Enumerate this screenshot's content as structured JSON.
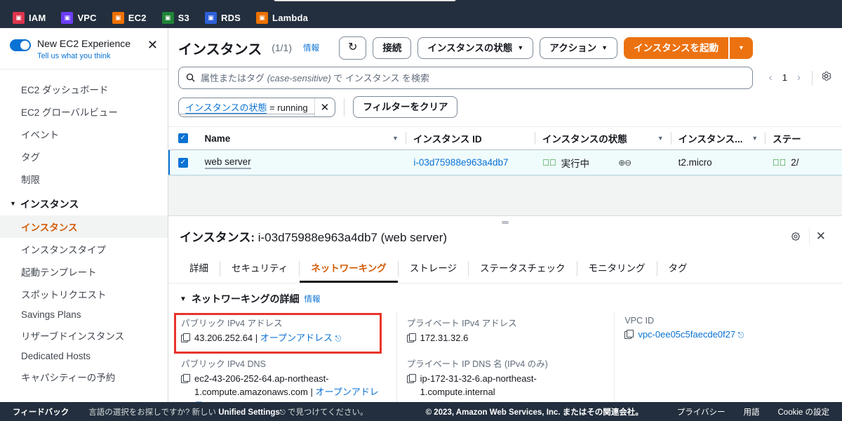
{
  "topnav": {
    "services": [
      {
        "label": "IAM",
        "icon": "iam-icon",
        "color": "#dd344c"
      },
      {
        "label": "VPC",
        "icon": "vpc-icon",
        "color": "#6b3df5"
      },
      {
        "label": "EC2",
        "icon": "ec2-icon",
        "color": "#ed7100"
      },
      {
        "label": "S3",
        "icon": "s3-icon",
        "color": "#1f8437"
      },
      {
        "label": "RDS",
        "icon": "rds-icon",
        "color": "#2e5fd9"
      },
      {
        "label": "Lambda",
        "icon": "lambda-icon",
        "color": "#ed7100"
      }
    ]
  },
  "sidebar": {
    "experience": {
      "title": "New EC2 Experience",
      "subtitle": "Tell us what you think",
      "toggle_on": true,
      "close_label": "✕"
    },
    "items": [
      {
        "label": "EC2 ダッシュボード",
        "active": false
      },
      {
        "label": "EC2 グローバルビュー",
        "active": false
      },
      {
        "label": "イベント",
        "active": false
      },
      {
        "label": "タグ",
        "active": false
      },
      {
        "label": "制限",
        "active": false
      }
    ],
    "group_label": "インスタンス",
    "group_items": [
      {
        "label": "インスタンス",
        "active": true
      },
      {
        "label": "インスタンスタイプ",
        "active": false
      },
      {
        "label": "起動テンプレート",
        "active": false
      },
      {
        "label": "スポットリクエスト",
        "active": false
      },
      {
        "label": "Savings Plans",
        "active": false
      },
      {
        "label": "リザーブドインスタンス",
        "active": false
      },
      {
        "label": "Dedicated Hosts",
        "active": false
      },
      {
        "label": "キャパシティーの予約",
        "active": false
      }
    ]
  },
  "header": {
    "title": "インスタンス",
    "count": "(1/1)",
    "info_label": "情報",
    "refresh_icon": "refresh-icon",
    "connect_label": "接続",
    "instance_state_label": "インスタンスの状態",
    "actions_label": "アクション",
    "launch_label": "インスタンスを起動",
    "caret": "▼"
  },
  "search": {
    "icon": "search-icon",
    "placeholder_a": "属性またはタグ",
    "placeholder_b": "(case-sensitive)",
    "placeholder_c": "で インスタンス を検索",
    "value": ""
  },
  "pager": {
    "prev": "‹",
    "page": "1",
    "next": "›",
    "settings_icon": "gear-icon"
  },
  "filters": {
    "token_key": "インスタンスの状態",
    "token_op": " = running",
    "token_remove": "✕",
    "clear_label": "フィルターをクリア"
  },
  "table": {
    "select_all_checked": true,
    "columns": [
      {
        "label": "Name",
        "sortable": true
      },
      {
        "label": "インスタンス ID",
        "sortable": false
      },
      {
        "label": "インスタンスの状態",
        "sortable": true
      },
      {
        "label": "インスタンス...",
        "sortable": true
      },
      {
        "label": "ステー",
        "sortable": false
      }
    ],
    "rows": [
      {
        "checked": true,
        "name": "web server",
        "instance_id": "i-03d75988e963a4db7",
        "state": "実行中",
        "state_icon": "check-circle-icon",
        "zoom_icons": "zoom-in-out-icon",
        "type": "t2.micro",
        "status": "2/",
        "status_icon": "check-circle-icon"
      }
    ]
  },
  "details": {
    "grabber": "═",
    "title_prefix": "インスタンス: ",
    "instance_id": "i-03d75988e963a4db7 (web server)",
    "gear_icon": "gear-icon",
    "close_icon": "close-icon",
    "tabs": [
      {
        "label": "詳細",
        "active": false
      },
      {
        "label": "セキュリティ",
        "active": false
      },
      {
        "label": "ネットワーキング",
        "active": true
      },
      {
        "label": "ストレージ",
        "active": false
      },
      {
        "label": "ステータスチェック",
        "active": false
      },
      {
        "label": "モニタリング",
        "active": false
      },
      {
        "label": "タグ",
        "active": false
      }
    ],
    "section": {
      "caret": "▼",
      "title": "ネットワーキングの詳細",
      "info_label": "情報"
    },
    "fields": [
      {
        "label": "パブリック IPv4 アドレス",
        "value": "43.206.252.64",
        "separator": " | ",
        "link": "オープンアドレス",
        "external": true,
        "copy": true,
        "highlight": true
      },
      {
        "label": "プライベート IPv4 アドレス",
        "value": "172.31.32.6",
        "separator": "",
        "link": "",
        "external": false,
        "copy": true,
        "highlight": false
      },
      {
        "label": "VPC ID",
        "value": "",
        "separator": "",
        "link": "vpc-0ee05c5faecde0f27",
        "external": true,
        "copy": true,
        "highlight": false
      },
      {
        "label": "パブリック IPv4 DNS",
        "value": "ec2-43-206-252-64.ap-northeast-1.compute.amazonaws.com",
        "separator": " | ",
        "link": "オープンアドレス",
        "external": true,
        "copy": true,
        "highlight": false
      },
      {
        "label": "プライベート IP DNS 名 (IPv4 のみ)",
        "value": "ip-172-31-32-6.ap-northeast-1.compute.internal",
        "separator": "",
        "link": "",
        "external": false,
        "copy": true,
        "highlight": false
      }
    ]
  },
  "footer": {
    "feedback": "フィードバック",
    "message_a": "言語の選択をお探しですか? 新しい ",
    "message_b": "Unified Settings",
    "message_c": " で見つけてください。",
    "copyright": "© 2023, Amazon Web Services, Inc. またはその関連会社。",
    "links": [
      "プライバシー",
      "用語",
      "Cookie の設定"
    ]
  },
  "colors": {
    "nav_bg": "#232f3e",
    "accent_orange": "#ec7211",
    "link_blue": "#0972d3",
    "highlight_red": "#e8342a",
    "success_green": "#037f0c"
  }
}
